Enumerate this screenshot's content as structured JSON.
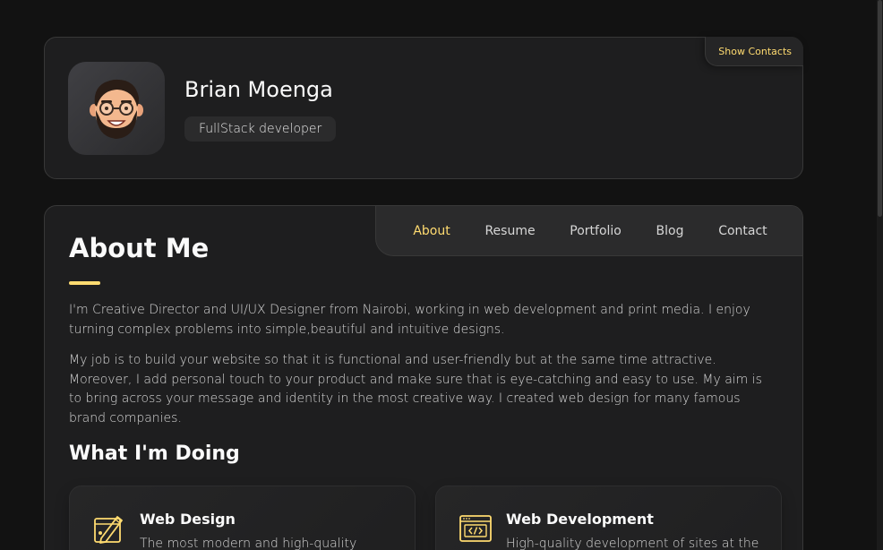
{
  "profile": {
    "name": "Brian Moenga",
    "role": "FullStack developer",
    "show_contacts_label": "Show Contacts"
  },
  "nav": {
    "items": [
      {
        "label": "About",
        "active": true
      },
      {
        "label": "Resume",
        "active": false
      },
      {
        "label": "Portfolio",
        "active": false
      },
      {
        "label": "Blog",
        "active": false
      },
      {
        "label": "Contact",
        "active": false
      }
    ]
  },
  "about": {
    "title": "About Me",
    "paragraphs": [
      "I'm Creative Director and UI/UX Designer from Nairobi, working in web development and print media. I enjoy turning complex problems into simple,beautiful and intuitive designs.",
      "My job is to build your website so that it is functional and user-friendly but at the same time attractive. Moreover, I add personal touch to your product and make sure that is eye-catching and easy to use. My aim is to bring across your message and identity in the most creative way. I created web design for many famous brand companies."
    ]
  },
  "doing": {
    "title": "What I'm Doing",
    "services": [
      {
        "title": "Web Design",
        "description": "The most modern and high-quality",
        "icon": "design-icon"
      },
      {
        "title": "Web Development",
        "description": "High-quality development of sites at the",
        "icon": "code-icon"
      }
    ]
  },
  "colors": {
    "accent": "#ffdb70",
    "background": "#121212",
    "card": "#1e1e1f"
  }
}
